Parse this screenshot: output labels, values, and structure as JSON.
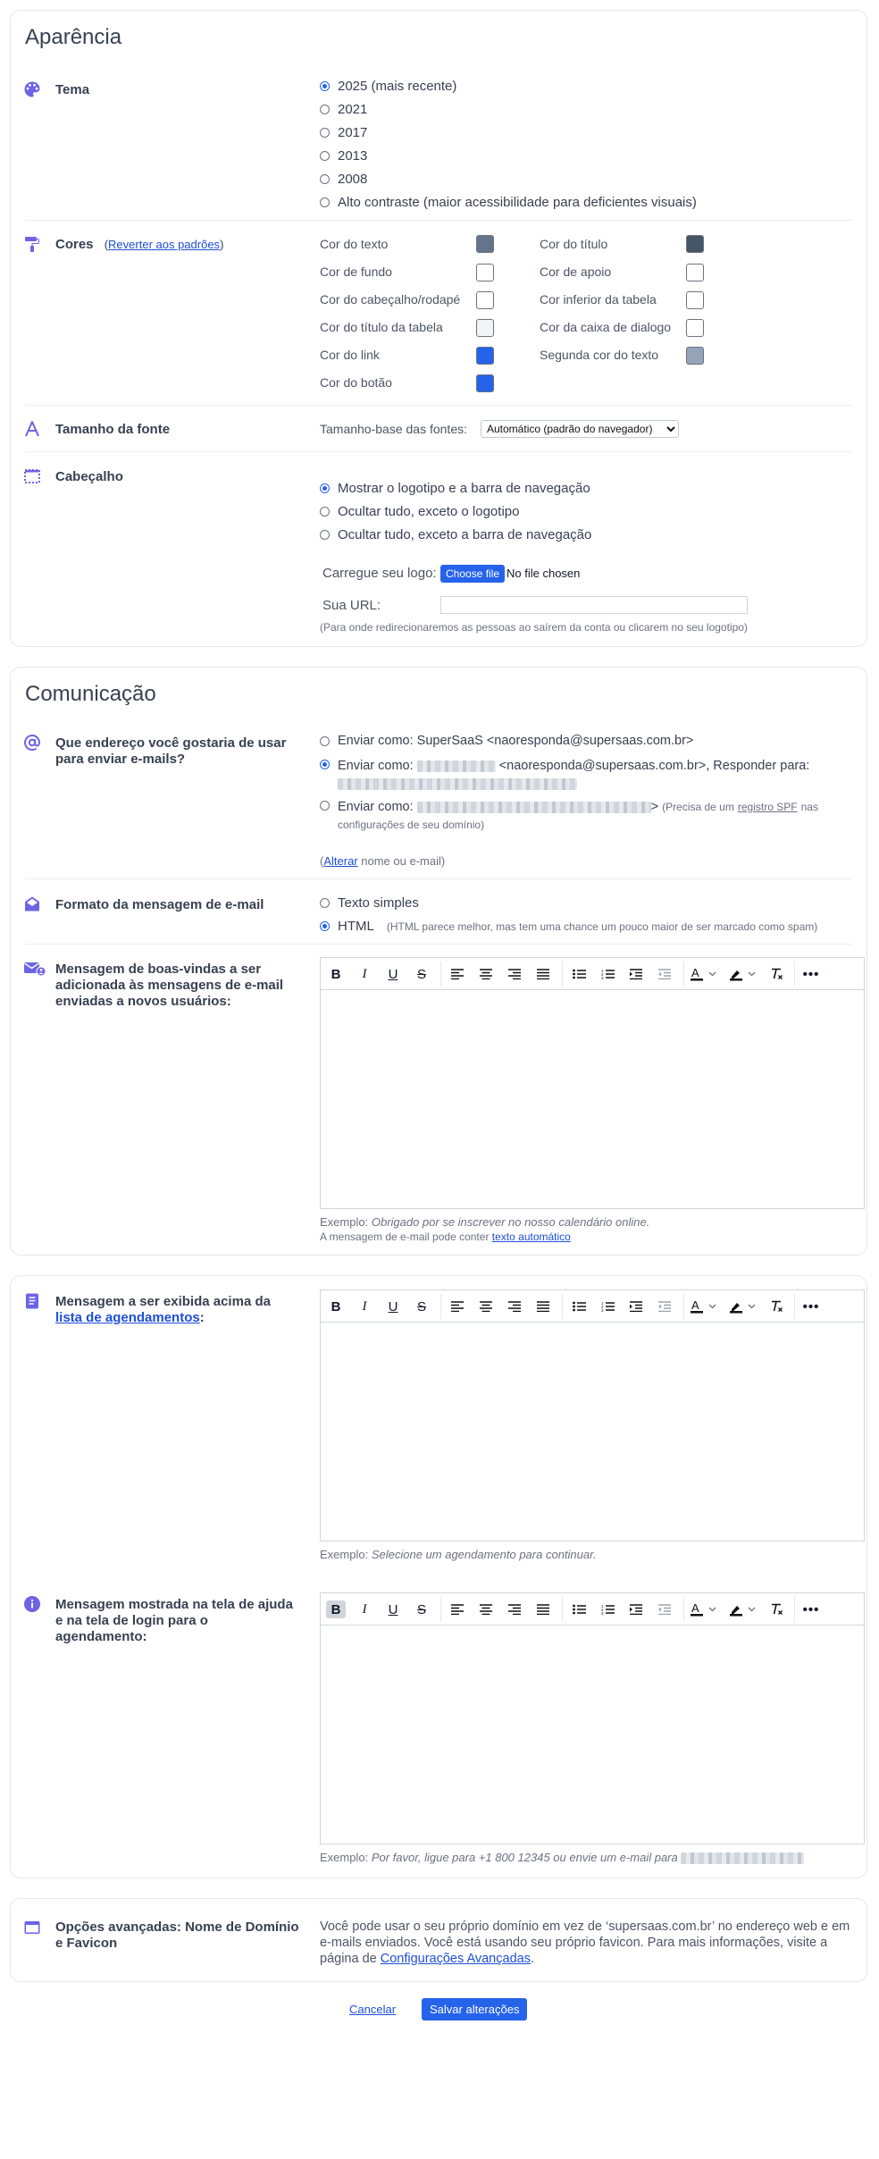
{
  "appearance": {
    "title": "Aparência",
    "theme": {
      "label": "Tema",
      "options": [
        "2025 (mais recente)",
        "2021",
        "2017",
        "2013",
        "2008",
        "Alto contraste (maior acessibilidade para deficientes visuais)"
      ],
      "selected": 0
    },
    "colors": {
      "label": "Cores",
      "reset_link": "Reverter aos padrões",
      "paren_open": "(",
      "paren_close": ")",
      "left": [
        {
          "label": "Cor do texto",
          "color": "#64748b"
        },
        {
          "label": "Cor de fundo",
          "color": "#ffffff"
        },
        {
          "label": "Cor do cabeçalho/rodapé",
          "color": "#ffffff"
        },
        {
          "label": "Cor do título da tabela",
          "color": "#f3f4f6"
        },
        {
          "label": "Cor do link",
          "color": "#2563eb"
        },
        {
          "label": "Cor do botão",
          "color": "#2563eb"
        }
      ],
      "right": [
        {
          "label": "Cor do título",
          "color": "#475569"
        },
        {
          "label": "Cor de apoio",
          "color": "#ffffff"
        },
        {
          "label": "Cor inferior da tabela",
          "color": "#ffffff"
        },
        {
          "label": "Cor da caixa de dialogo",
          "color": "#ffffff"
        },
        {
          "label": "Segunda cor do texto",
          "color": "#94a3b8"
        }
      ]
    },
    "font_size": {
      "label": "Tamanho da fonte",
      "base_label": "Tamanho-base das fontes:",
      "selected": "Automático (padrão do navegador)"
    },
    "header": {
      "label": "Cabeçalho",
      "options": [
        "Mostrar o logotipo e a barra de navegação",
        "Ocultar tudo, exceto o logotipo",
        "Ocultar tudo, exceto a barra de navegação"
      ],
      "selected": 0,
      "upload_label": "Carregue seu logo:",
      "choose_file": "Choose file",
      "no_file": "No file chosen",
      "url_label": "Sua URL:",
      "url_value": "",
      "url_hint": "(Para onde redirecionaremos as pessoas ao saírem da conta ou clicarem no seu logotipo)"
    }
  },
  "communication": {
    "title": "Comunicação",
    "sender": {
      "label": "Que endereço você gostaria de usar para enviar e-mails?",
      "option1": "Enviar como: SuperSaaS <naoresponda@supersaas.com.br>",
      "option2_prefix": "Enviar como:",
      "option2_mid": "<naoresponda@supersaas.com.br>, Responder para:",
      "option3_prefix": "Enviar como:",
      "option3_suffix": ">",
      "option3_note_a": "(Precisa de um",
      "option3_note_link": "registro SPF",
      "option3_note_b": "nas",
      "option3_note_c": "configurações de seu domínio)",
      "selected": 1,
      "alter_open": "(",
      "alter_link": "Alterar",
      "alter_rest": "nome ou e-mail)"
    },
    "format": {
      "label": "Formato da mensagem de e-mail",
      "plain": "Texto simples",
      "html": "HTML",
      "html_note": "(HTML parece melhor, mas tem uma chance um pouco maior de ser marcado como spam)",
      "selected": "html"
    },
    "welcome": {
      "label": "Mensagem de boas-vindas a ser adicionada às mensagens de e-mail enviadas a novos usuários:",
      "example_prefix": "Exemplo:",
      "example_text": "Obrigado por se inscrever no nosso calendário online.",
      "auto_prefix": "A mensagem de e-mail pode conter",
      "auto_link": "texto automático"
    }
  },
  "messages": {
    "above_list": {
      "label_a": "Mensagem a ser exibida acima da",
      "label_link": "lista de agendamentos",
      "label_colon": ":",
      "example_prefix": "Exemplo:",
      "example_text": "Selecione um agendamento para continuar."
    },
    "help": {
      "label": "Mensagem mostrada na tela de ajuda e na tela de login para o agendamento:",
      "example_prefix": "Exemplo:",
      "example_text": "Por favor, ligue para +1 800 12345 ou envie um e-mail para"
    }
  },
  "advanced": {
    "label": "Opções avançadas: Nome de Domínio e Favicon",
    "text": "Você pode usar o seu próprio domínio em vez de ‘supersaas.com.br’ no endereço web e em e-mails enviados. Você está usando seu próprio favicon. Para mais informações, visite a página de",
    "link": "Configurações Avançadas",
    "dot": "."
  },
  "footer": {
    "cancel": "Cancelar",
    "save": "Salvar alterações"
  },
  "icons": {
    "theme": "palette-icon",
    "colors": "paint-roller-icon",
    "font": "font-letter-icon",
    "header": "dotted-frame-icon",
    "sender": "at-sign-icon",
    "format": "envelope-open-icon",
    "welcome": "envelope-user-icon",
    "above_list": "document-list-icon",
    "help": "info-circle-icon",
    "advanced": "browser-window-icon"
  },
  "accent_color": "#6d63e6",
  "link_color": "#1d4ed8",
  "button_color": "#2563eb"
}
